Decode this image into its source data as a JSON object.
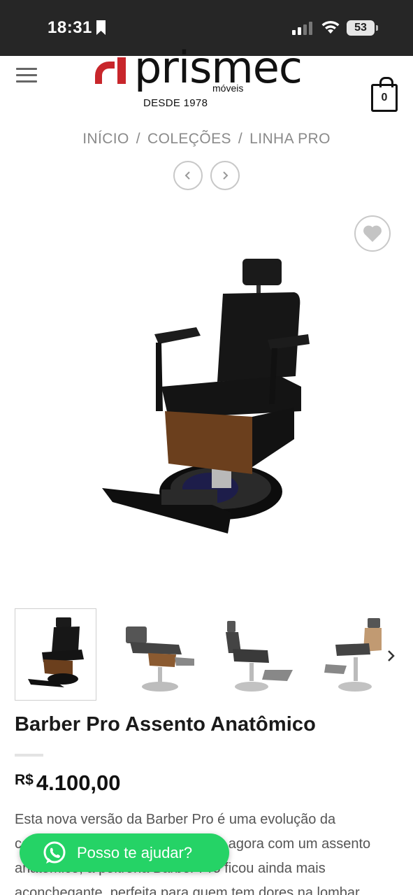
{
  "status_bar": {
    "time": "18:31",
    "battery": "53"
  },
  "header": {
    "logo_word": "prismec",
    "logo_sub": "móveis",
    "logo_since": "DESDE 1978",
    "cart_count": "0",
    "brand_color": "#c8262b"
  },
  "breadcrumb": {
    "items": [
      "INÍCIO",
      "COLEÇÕES",
      "LINHA PRO"
    ],
    "separator": "/"
  },
  "product": {
    "title": "Barber Pro Assento Anatômico",
    "currency": "R$",
    "price": "4.100,00",
    "description": "Esta nova versão da Barber Pro é uma evolução da cadeira mais vendida da Prismec, agora com um assento anatômico, a poltrona Barber Pro ficou ainda mais aconchegante, perfeita para quem tem dores na lombar"
  },
  "whatsapp": {
    "label": "Posso te ajudar?",
    "color": "#25d366"
  }
}
